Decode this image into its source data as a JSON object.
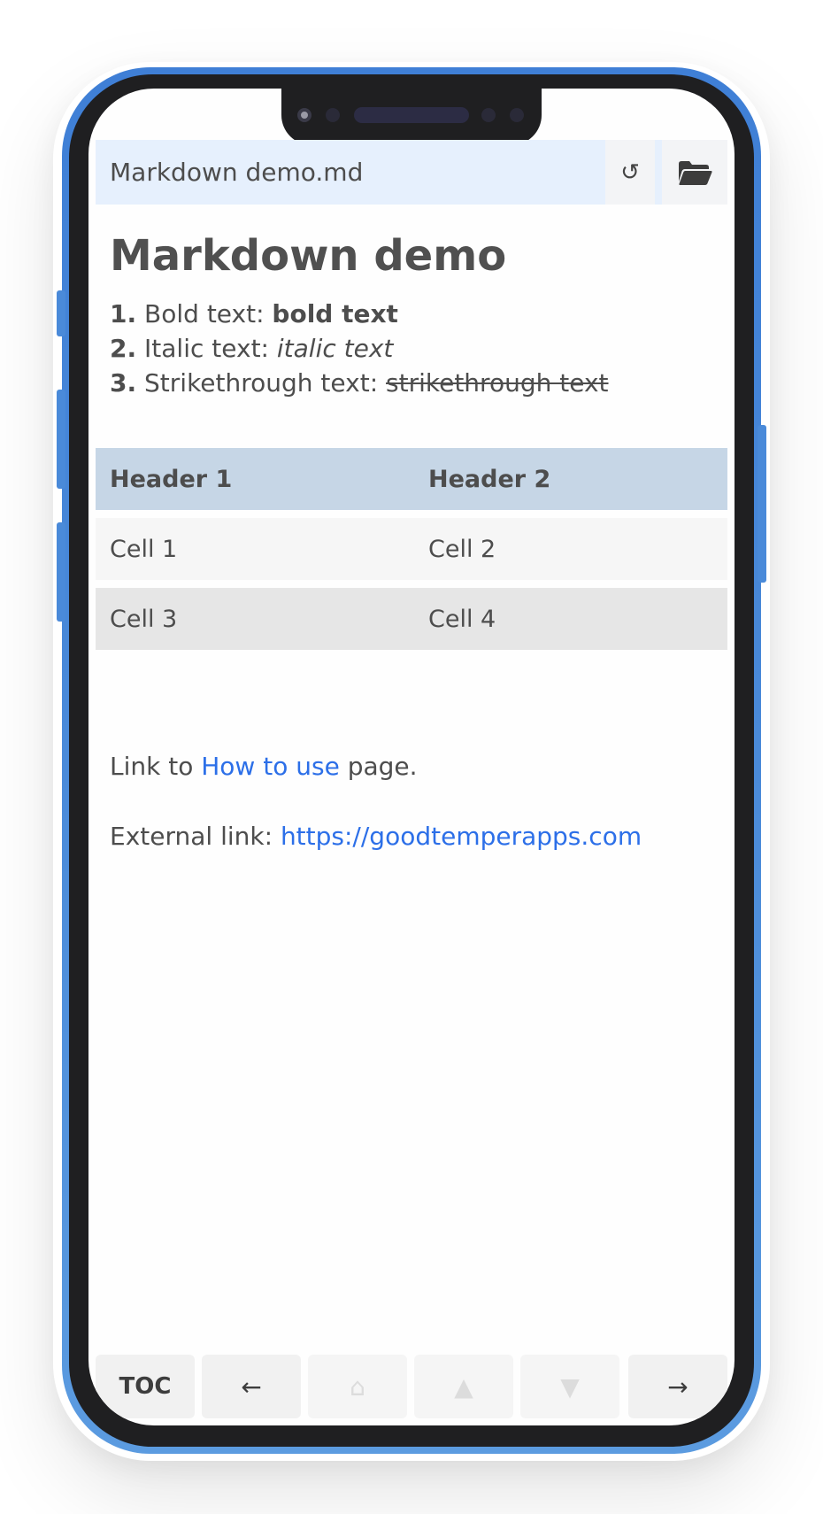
{
  "file_bar": {
    "title": "Markdown demo.md",
    "reload_icon": "reload-icon",
    "folder_icon": "folder-open-icon",
    "reload_glyph": "↺"
  },
  "document": {
    "title": "Markdown demo",
    "list": [
      {
        "num": "1.",
        "label": "Bold text: ",
        "value": "bold text",
        "style": "bold"
      },
      {
        "num": "2.",
        "label": "Italic text: ",
        "value": "italic text",
        "style": "italic"
      },
      {
        "num": "3.",
        "label": "Strikethrough text: ",
        "value": "strikethrough text",
        "style": "strikethrough"
      }
    ],
    "table": {
      "headers": [
        "Header 1",
        "Header 2"
      ],
      "rows": [
        [
          "Cell 1",
          "Cell 2"
        ],
        [
          "Cell 3",
          "Cell 4"
        ]
      ]
    },
    "internal_link": {
      "prefix": "Link to ",
      "text": "How to use",
      "suffix": " page."
    },
    "external_link": {
      "prefix": "External link: ",
      "text": "https://goodtemperapps.com"
    }
  },
  "bottom_bar": {
    "toc_label": "TOC",
    "back_glyph": "←",
    "home_glyph": "⌂",
    "up_glyph": "▲",
    "down_glyph": "▼",
    "forward_glyph": "→"
  },
  "colors": {
    "file_bar_bg": "#e6f0fd",
    "table_header_bg": "#c6d6e6",
    "link": "#2c6fe8",
    "phone_frame": "#4a8ad9"
  }
}
